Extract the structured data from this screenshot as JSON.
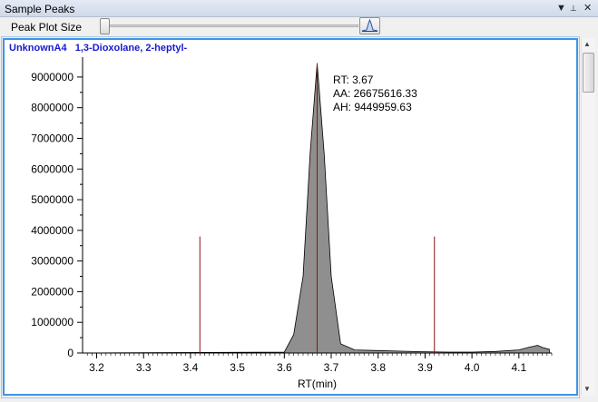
{
  "window": {
    "title": "Sample Peaks",
    "menu_glyph": "▼",
    "pin_glyph": "📌",
    "close_glyph": "✕"
  },
  "toolbar": {
    "peak_plot_size_label": "Peak Plot Size",
    "peak_plot_size_value": 0.0
  },
  "chart_header": {
    "compound_id": "UnknownA4",
    "compound_name": "1,3-Dioxolane, 2-heptyl-"
  },
  "annotation": {
    "rt": "RT: 3.67",
    "aa": "AA: 26675616.33",
    "ah": "AH: 9449959.63"
  },
  "colors": {
    "accent": "#3c96e6",
    "header_text": "#1a1ad0",
    "peak_fill": "#8f8f8f",
    "marker_line": "#8b1010"
  },
  "chart_data": {
    "type": "area",
    "title": "",
    "xlabel": "RT(min)",
    "ylabel": "",
    "xlim": [
      3.17,
      4.17
    ],
    "ylim": [
      0,
      9500000
    ],
    "x_ticks": [
      "3.2",
      "3.3",
      "3.4",
      "3.5",
      "3.6",
      "3.7",
      "3.8",
      "3.9",
      "4.0",
      "4.1"
    ],
    "y_ticks": [
      "0",
      "1000000",
      "2000000",
      "3000000",
      "4000000",
      "5000000",
      "6000000",
      "7000000",
      "8000000",
      "9000000"
    ],
    "series": [
      {
        "x": [
          3.17,
          3.6,
          3.62,
          3.64,
          3.655,
          3.67,
          3.685,
          3.7,
          3.72,
          3.75,
          3.8,
          3.85,
          3.9,
          3.95,
          4.0,
          4.05,
          4.1,
          4.12,
          4.14,
          4.15,
          4.165
        ],
        "y": [
          0,
          30000,
          600000,
          2500000,
          6500000,
          9449959,
          6500000,
          2500000,
          300000,
          100000,
          80000,
          60000,
          40000,
          30000,
          30000,
          50000,
          100000,
          180000,
          250000,
          180000,
          120000
        ]
      }
    ],
    "vertical_markers": [
      {
        "x": 3.42,
        "y": 3800000
      },
      {
        "x": 3.67,
        "y": 9449959
      },
      {
        "x": 3.92,
        "y": 3800000
      }
    ]
  }
}
